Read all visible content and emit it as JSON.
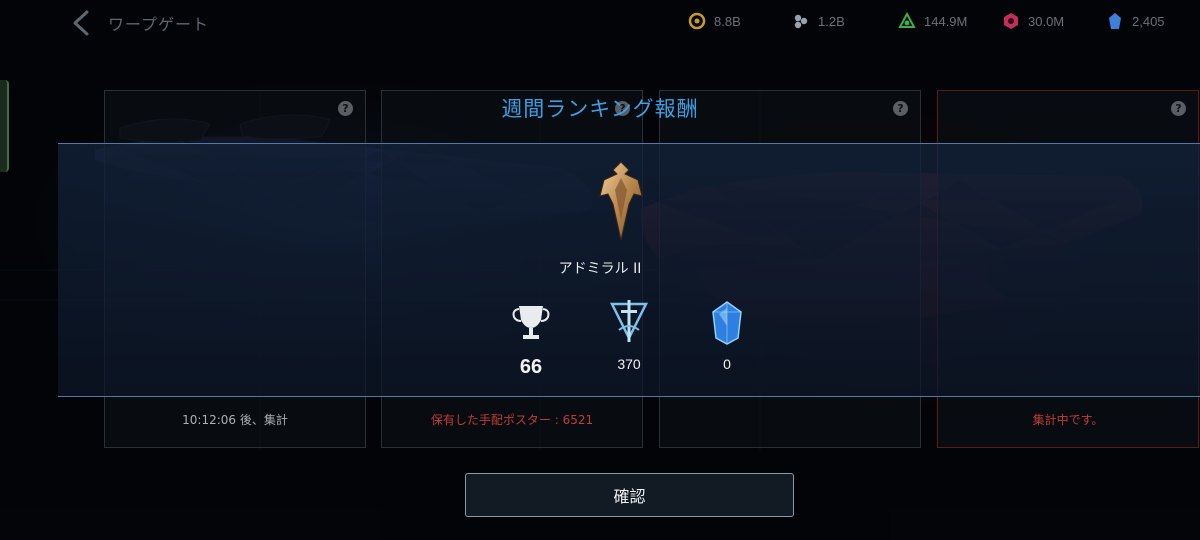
{
  "header": {
    "title": "ワープゲート",
    "resources": [
      {
        "icon": "parsteel-icon",
        "value": "8.8B",
        "color": "#c89b2c"
      },
      {
        "icon": "tritanium-icon",
        "value": "1.2B",
        "color": "#9aa3ad"
      },
      {
        "icon": "dilithium-icon",
        "value": "144.9M",
        "color": "#3fae4a"
      },
      {
        "icon": "latinum-icon",
        "value": "30.0M",
        "color": "#c0305a"
      },
      {
        "icon": "crystal-icon",
        "value": "2,405",
        "color": "#3d7fd9"
      }
    ]
  },
  "background_cards": [
    {
      "subtext": "10:12:06 後、集計",
      "subtext_color": "#a9b0b8"
    },
    {
      "subtext": "保有した手配ポスター : 6521",
      "subtext_color": "#c23a3a"
    },
    {
      "subtext": "",
      "subtext_color": "#a9b0b8"
    },
    {
      "subtext": "集計中です。",
      "subtext_color": "#c23a3a"
    }
  ],
  "modal": {
    "title": "週間ランキング報酬",
    "rank_name": "アドミラル II",
    "rewards": [
      {
        "icon": "trophy-icon",
        "value": "66"
      },
      {
        "icon": "sword-emblem-icon",
        "value": "370"
      },
      {
        "icon": "blue-crystal-icon",
        "value": "0"
      }
    ],
    "confirm_label": "確認"
  }
}
